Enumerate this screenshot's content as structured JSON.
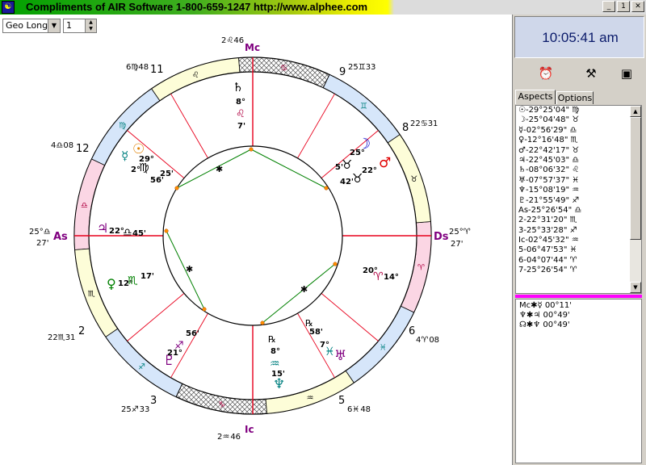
{
  "title": "Compliments of AIR Software 1-800-659-1247 http://www.alphee.com",
  "window_buttons": {
    "minimize": "_",
    "maximize": "1",
    "close": "✕"
  },
  "toolbar": {
    "coord_mode": "Geo Long",
    "step_value": "1"
  },
  "clock": "10:05:41 am",
  "tabs": {
    "aspects": "Aspects",
    "options": "Options"
  },
  "positions": [
    "☉-29°25'04\" ♍",
    "☽-25°04'48\" ♉",
    "☿-02°56'29\" ♎",
    "♀-12°16'48\" ♏",
    "♂-22°42'17\" ♉",
    "♃-22°45'03\" ♎",
    "♄-08°06'32\" ♌",
    "♅-07°57'37\" ♓",
    "♆-15°08'19\" ♒",
    "♇-21°55'49\" ♐",
    "As-25°26'54\" ♎",
    "2-22°31'20\" ♏",
    "3-25°33'28\" ♐",
    "Ic-02°45'32\" ♒",
    "5-06°47'53\" ♓",
    "6-04°07'44\" ♈",
    "7-25°26'54\" ♈"
  ],
  "aspect_pairs": [
    "Mc✱☿  00°11'",
    "♆✱♃  00°49'",
    "☊✱♆  00°49'"
  ],
  "chart": {
    "angle_labels": {
      "as": "As",
      "as_deg": "25°♎",
      "as_min": "27'",
      "ds": "Ds",
      "ds_deg": "25°♈",
      "ds_min": "27'",
      "mc": "Mc",
      "mc_deg": "2♌46",
      "ic": "Ic",
      "ic_deg": "2♒ 46"
    },
    "house_numbers": [
      "11",
      "9",
      "8",
      "12",
      "2",
      "6",
      "3",
      "5"
    ],
    "house_cusps": [
      "6♍48",
      "25♊33",
      "22♋31",
      "4♎08",
      "22♏31",
      "4♈ 08",
      "25♐ 33",
      "6♓ 48"
    ],
    "planets": {
      "saturn": {
        "glyph": "♄",
        "deg": "8°",
        "sign": "♌",
        "min": "7'"
      },
      "moon": {
        "glyph": "☽",
        "deg": "25°",
        "min": "5'"
      },
      "mars": {
        "glyph": "♂",
        "deg": "22°",
        "min": "42'"
      },
      "sun": {
        "glyph": "☉",
        "deg": "29°",
        "min": "25'"
      },
      "mercury": {
        "glyph": "☿",
        "deg": "2°",
        "min": "56'"
      },
      "jupiter": {
        "glyph": "♃",
        "deg": "22°",
        "min": "45'"
      },
      "venus": {
        "glyph": "♀",
        "deg": "12°",
        "min": "17'"
      },
      "pluto": {
        "glyph": "♇",
        "deg": "21°",
        "min": "56'"
      },
      "neptune": {
        "glyph": "♆",
        "deg": "8°",
        "min": "15'",
        "retro": "℞"
      },
      "uranus": {
        "glyph": "♅",
        "deg": "7°",
        "min": "58'",
        "retro": "℞"
      },
      "node": {
        "deg": "20°",
        "sign": "♈",
        "min": "14°"
      }
    },
    "aspect_star": "✱"
  },
  "colors": {
    "house_line": "#e8001c",
    "aspect_line": "#008000",
    "ring_pink": "#fbd6e4",
    "ring_yellow": "#fdfdd8",
    "ring_blue": "#d6e6fa"
  }
}
